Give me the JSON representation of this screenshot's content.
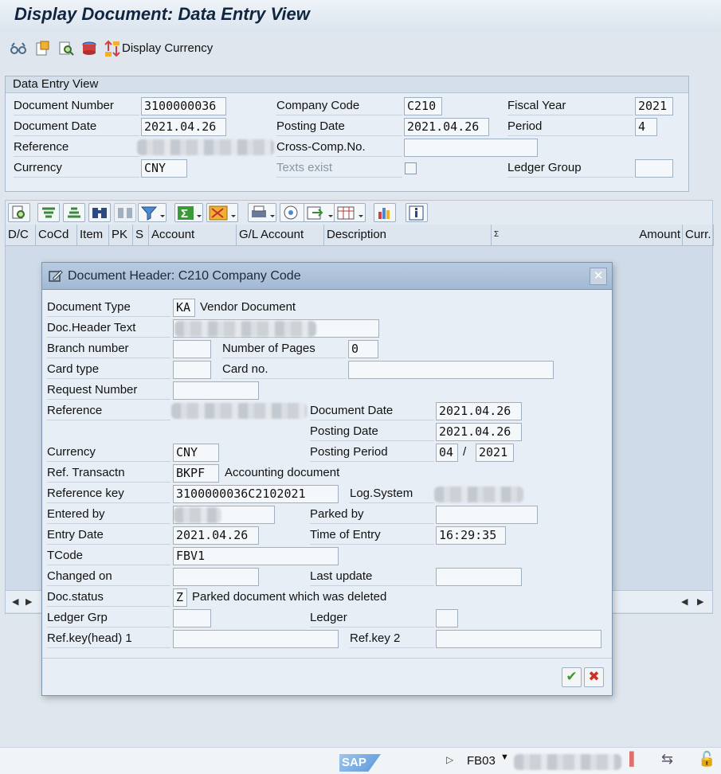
{
  "title": "Display Document: Data Entry View",
  "toolbar": {
    "display_currency_label": "Display Currency"
  },
  "entry_view": {
    "group_title": "Data Entry View",
    "document_number_label": "Document Number",
    "document_number": "3100000036",
    "company_code_label": "Company Code",
    "company_code": "C210",
    "fiscal_year_label": "Fiscal Year",
    "fiscal_year": "2021",
    "document_date_label": "Document Date",
    "document_date": "2021.04.26",
    "posting_date_label": "Posting Date",
    "posting_date": "2021.04.26",
    "period_label": "Period",
    "period": "4",
    "reference_label": "Reference",
    "cross_comp_label": "Cross-Comp.No.",
    "currency_label": "Currency",
    "currency": "CNY",
    "texts_exist_label": "Texts exist",
    "ledger_group_label": "Ledger Group"
  },
  "grid": {
    "columns": [
      "D/C",
      "CoCd",
      "Item",
      "PK",
      "S",
      "Account",
      "G/L Account",
      "Description",
      "Σ",
      "Amount",
      "Curr."
    ]
  },
  "dialog": {
    "title": "Document Header: C210 Company Code",
    "document_type_label": "Document Type",
    "document_type": "KA",
    "document_type_text": "Vendor Document",
    "doc_header_text_label": "Doc.Header Text",
    "branch_number_label": "Branch number",
    "number_of_pages_label": "Number of Pages",
    "number_of_pages": "0",
    "card_type_label": "Card type",
    "card_no_label": "Card no.",
    "request_number_label": "Request Number",
    "reference_label": "Reference",
    "document_date_label": "Document Date",
    "document_date": "2021.04.26",
    "posting_date_label": "Posting Date",
    "posting_date": "2021.04.26",
    "currency_label": "Currency",
    "currency": "CNY",
    "posting_period_label": "Posting Period",
    "posting_period": "04",
    "posting_period_sep": "/",
    "posting_year": "2021",
    "ref_transactn_label": "Ref. Transactn",
    "ref_transactn": "BKPF",
    "ref_transactn_text": "Accounting document",
    "reference_key_label": "Reference key",
    "reference_key": "3100000036C2102021",
    "log_system_label": "Log.System",
    "entered_by_label": "Entered by",
    "parked_by_label": "Parked by",
    "entry_date_label": "Entry Date",
    "entry_date": "2021.04.26",
    "time_of_entry_label": "Time of Entry",
    "time_of_entry": "16:29:35",
    "tcode_label": "TCode",
    "tcode": "FBV1",
    "changed_on_label": "Changed on",
    "last_update_label": "Last update",
    "doc_status_label": "Doc.status",
    "doc_status": "Z",
    "doc_status_text": "Parked document which was deleted",
    "ledger_grp_label": "Ledger Grp",
    "ledger_label": "Ledger",
    "ref_key_head1_label": "Ref.key(head) 1",
    "ref_key2_label": "Ref.key 2"
  },
  "status_bar": {
    "sap_logo": "SAP",
    "tcode": "FB03"
  }
}
